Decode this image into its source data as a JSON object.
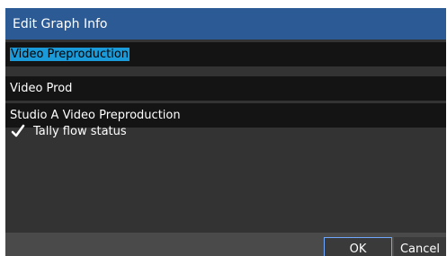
{
  "dialog": {
    "title": "Edit Graph Info",
    "fields": [
      {
        "value": "Video Preproduction",
        "selected": true
      },
      {
        "value": "Video Prod"
      },
      {
        "value": "Studio A Video Preproduction"
      }
    ],
    "checkbox": {
      "label": "Tally flow status",
      "checked": true
    },
    "buttons": {
      "ok": "OK",
      "cancel": "Cancel"
    }
  },
  "colors": {
    "title_bar": "#2b5a94",
    "dialog_bg": "#333333",
    "field_bg": "#141414",
    "selection": "#1a9ad8",
    "ok_border": "#6ea8ff"
  },
  "icons": {
    "checkbox": "checkmark-icon"
  }
}
